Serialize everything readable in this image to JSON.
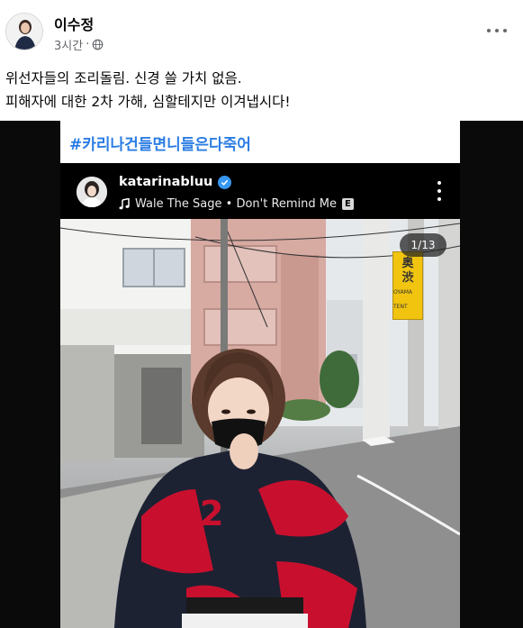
{
  "post": {
    "author": "이수정",
    "time": "3시간",
    "privacy_icon": "globe-icon",
    "text_lines": [
      "위선자들의 조리돌림. 신경 쓸 가치 없음.",
      "피해자에 대한 2차 가해, 심할테지만 이겨냅시다!"
    ]
  },
  "media": {
    "hashtag": "#카리나건들면니들은다죽어",
    "instagram": {
      "username": "katarinabluu",
      "music_icon": "music-note-icon",
      "music": "Wale The Sage • Don't Remind Me",
      "explicit_badge": "E",
      "photo_counter": "1/13"
    },
    "sign_text": [
      "奥",
      "渋"
    ],
    "sign_small": "OYAMA TENT"
  },
  "colors": {
    "hashtag_blue": "#2b7de3",
    "verified_blue": "#3897f0",
    "jacket_red": "#c8102e"
  }
}
